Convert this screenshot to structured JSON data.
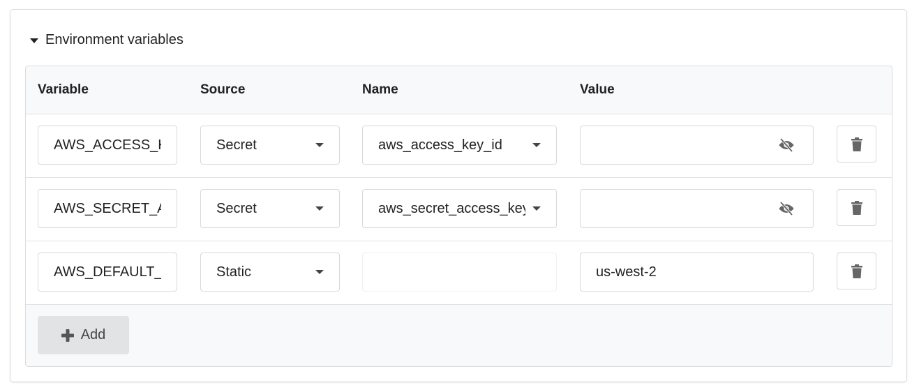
{
  "section": {
    "title": "Environment variables",
    "expanded": true,
    "icon": "caret-down-icon"
  },
  "table": {
    "headers": {
      "variable": "Variable",
      "source": "Source",
      "name": "Name",
      "value": "Value"
    },
    "rows": [
      {
        "variable": "AWS_ACCESS_K",
        "source": "Secret",
        "name": "aws_access_key_id",
        "value": "",
        "value_icon": "eye-slash-icon",
        "delete_icon": "trash-icon"
      },
      {
        "variable": "AWS_SECRET_A",
        "source": "Secret",
        "name": "aws_secret_access_key",
        "value": "",
        "value_icon": "eye-slash-icon",
        "delete_icon": "trash-icon"
      },
      {
        "variable": "AWS_DEFAULT_",
        "source": "Static",
        "name": "",
        "value": "us-west-2",
        "delete_icon": "trash-icon"
      }
    ]
  },
  "footer": {
    "add_label": "Add",
    "add_icon": "plus-icon"
  },
  "colors": {
    "text": "#222222",
    "icon": "#666666",
    "border": "#d9d9d9",
    "header_bg": "#f8f9fa",
    "add_button_bg": "#e2e3e5"
  }
}
